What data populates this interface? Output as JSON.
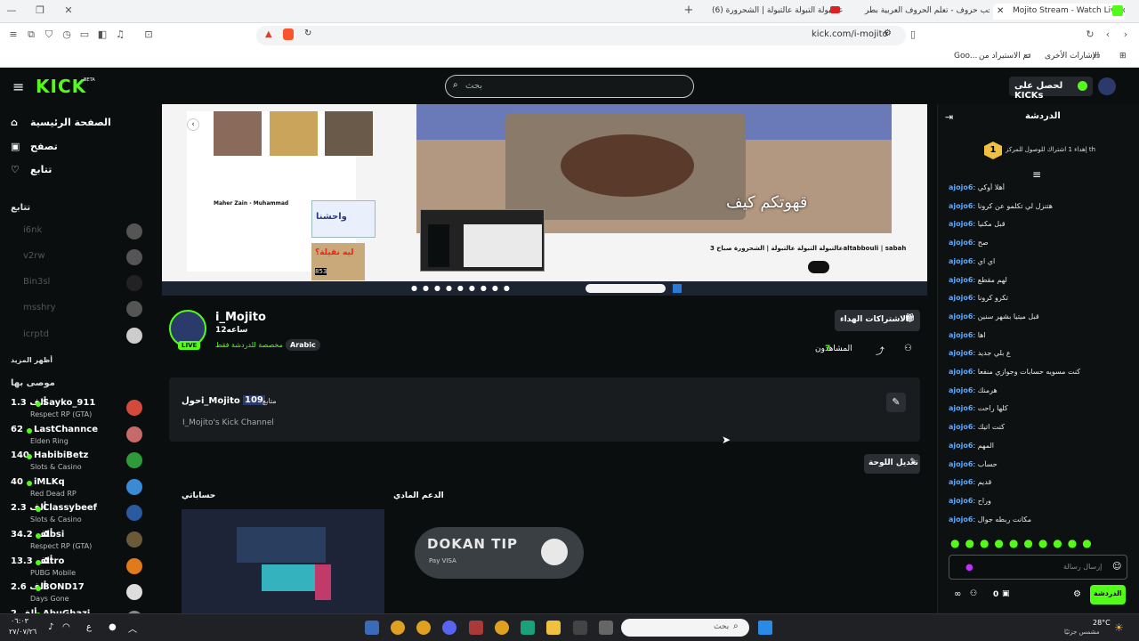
{
  "browser": {
    "tabs": [
      {
        "label": "Mojito Stream - Watch Live on"
      },
      {
        "label": "الحب حروف - تعلم الحروف العربية بطر"
      },
      {
        "label": "(6) عالتبولة التبولة عالتبولة | الشحرورة"
      }
    ],
    "url": "kick.com/i-mojito",
    "bookmarks": [
      "الإشارات الأخرى",
      "تم الاستيراد من",
      "Goo..."
    ]
  },
  "kick": {
    "logo": "KICK",
    "logo_beta": "BETA",
    "search_placeholder": "بحث",
    "get_kicks": "لحصل على KICKs",
    "nav": [
      "الصفحة الرئيسية",
      "تصفح",
      "تتابع"
    ],
    "following_title": "تتابع",
    "following": [
      "i6nk",
      "v2rw",
      "Bin3sl",
      "msshry",
      "icrptd"
    ],
    "show_more": "أظهر المزيد",
    "recommended_title": "موصى بها",
    "recommended": [
      {
        "viewers": "1.3 ألف",
        "name": "Sayko_911",
        "category": "Respect RP (GTA)",
        "color": "#d44a3a"
      },
      {
        "viewers": "62",
        "name": "LastChannce",
        "category": "Elden Ring",
        "color": "#c76a6a"
      },
      {
        "viewers": "140",
        "name": "HabibiBetz",
        "category": "Slots & Casino",
        "color": "#2f9a3a"
      },
      {
        "viewers": "40",
        "name": "iMLKq",
        "category": "Red Dead RP",
        "color": "#3a8ad4"
      },
      {
        "viewers": "2.3 ألف",
        "name": "Classybeef",
        "category": "Slots & Casino",
        "color": "#2a5aa0"
      },
      {
        "viewers": "34.2 ألف",
        "name": "Absi",
        "category": "Respect RP (GTA)",
        "color": "#6a5a3a"
      },
      {
        "viewers": "13.3 ألف",
        "name": "Atro",
        "category": "PUBG Mobile",
        "color": "#e07a1a"
      },
      {
        "viewers": "2.6 ألف",
        "name": "BOND17",
        "category": "Days Gone",
        "color": "#dddddd"
      },
      {
        "viewers": "2 ألف",
        "name": "AbuGhazi",
        "category": "",
        "color": "#888888"
      }
    ]
  },
  "video": {
    "overlay_text": "قهوتكم كيف",
    "video_title": "عالتبولة التبولة عالتبولة | الشحرورة صباح 3altabbouli | sabah",
    "recommended_titles": [
      "واحشنا",
      "ليه نقيلة؟",
      "Maher Zain - Muhammad"
    ],
    "views": "853"
  },
  "channel": {
    "name": "i_Mojito",
    "followers": "12ساعه",
    "tag_language": "Arabic",
    "tag_chat": "مخصصة للدردشة فقط",
    "live_badge": "LIVE",
    "gift_button": "الاشتراكات الهداء",
    "viewers_label": "المشاهدون",
    "viewers_count": "7"
  },
  "about": {
    "title_prefix": "حول",
    "name": "i_Mojito",
    "followers_count": "109",
    "followers_label": "متابع",
    "bio": "I_Mojito's Kick Channel",
    "edit_panels": "تعديل اللوحة",
    "panel1_title": "حساباتي",
    "panel2_title": "الدعم المادي",
    "donate_brand": "DOKAN TIP",
    "payment_methods": "Pay VISA"
  },
  "chat": {
    "title": "الدردشة",
    "gift_banner": "إهداء 1 اشتراك للوصول للمركز th",
    "gift_rank": "1",
    "messages": [
      {
        "user": "ajojo6",
        "text": "أهلا أوكي"
      },
      {
        "user": "ajojo6",
        "text": "هتنزل لي تكلمو عن كرونا"
      },
      {
        "user": "ajojo6",
        "text": "قبل مكنيا"
      },
      {
        "user": "ajojo6",
        "text": "صح"
      },
      {
        "user": "ajojo6",
        "text": "اي اي"
      },
      {
        "user": "ajojo6",
        "text": "لهم مقطع"
      },
      {
        "user": "ajojo6",
        "text": "تكرو كرونا"
      },
      {
        "user": "ajojo6",
        "text": "قبل ميتيا بشهر سنين"
      },
      {
        "user": "ajojo6",
        "text": "اها"
      },
      {
        "user": "ajojo6",
        "text": "ع بلي جديد"
      },
      {
        "user": "ajojo6",
        "text": "كنت مسويه حسابات وجوازي منفعا"
      },
      {
        "user": "ajojo6",
        "text": "هرمنك"
      },
      {
        "user": "ajojo6",
        "text": "كلها راحت"
      },
      {
        "user": "ajojo6",
        "text": "كنت اتيك"
      },
      {
        "user": "ajojo6",
        "text": "المهم"
      },
      {
        "user": "ajojo6",
        "text": "حسأب"
      },
      {
        "user": "ajojo6",
        "text": "قديم"
      },
      {
        "user": "ajojo6",
        "text": "وراح"
      },
      {
        "user": "ajojo6",
        "text": "مكانت ربطه جوال"
      }
    ],
    "input_placeholder": "إرسال رسالة",
    "send_button": "الدردشة",
    "kicks_count": "0"
  },
  "taskbar": {
    "time": "٠٦:٠٣",
    "date": "٢٧/٠٧/٢٦",
    "lang": "ع",
    "search_placeholder": "بحث",
    "weather_temp": "28°C",
    "weather_desc": "مشمس جزئيًا"
  },
  "colors": {
    "kick_green": "#53fc18",
    "chat_user": "#5aa8ff",
    "bg": "#0b0e0f"
  }
}
